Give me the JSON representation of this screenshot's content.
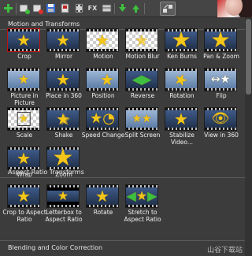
{
  "toolbar": {
    "buttons": [
      {
        "icon": "add-icon"
      },
      {
        "icon": "add-media-icon"
      },
      {
        "icon": "remove-media-icon"
      },
      {
        "icon": "save-icon"
      },
      {
        "icon": "clip-icon"
      },
      {
        "icon": "film-icon"
      },
      {
        "icon": "fx-icon"
      },
      {
        "icon": "sequence-icon"
      },
      {
        "icon": "move-down-icon"
      },
      {
        "icon": "move-up-icon"
      },
      {
        "icon": "transitions-icon"
      }
    ],
    "fx_label": "FX"
  },
  "sections": [
    {
      "title": "Motion and Transforms",
      "effects": [
        {
          "label": "Crop"
        },
        {
          "label": "Mirror"
        },
        {
          "label": "Motion"
        },
        {
          "label": "Motion Blur"
        },
        {
          "label": "Ken Burns"
        },
        {
          "label": "Pan & Zoom"
        },
        {
          "label": "Picture in Picture"
        },
        {
          "label": "Place in 360"
        },
        {
          "label": "Position"
        },
        {
          "label": "Reverse"
        },
        {
          "label": "Rotation"
        },
        {
          "label": "Flip"
        },
        {
          "label": "Scale"
        },
        {
          "label": "Shake"
        },
        {
          "label": "Speed Change"
        },
        {
          "label": "Split Screen"
        },
        {
          "label": "Stabilize Video..."
        },
        {
          "label": "View in 360"
        },
        {
          "label": "Wrap"
        },
        {
          "label": "Zoom"
        }
      ]
    },
    {
      "title": "Aspect Ratio Transforms",
      "effects": [
        {
          "label": "Crop to Aspect Ratio"
        },
        {
          "label": "Letterbox to Aspect Ratio"
        },
        {
          "label": "Rotate"
        },
        {
          "label": "Stretch to Aspect Ratio"
        }
      ]
    },
    {
      "title": "Blending and Color Correction",
      "effects": []
    }
  ],
  "watermark": "山谷下载站",
  "colors": {
    "star": "#f4c61a",
    "panel_bg": "#3c3c3c",
    "thumb_bg": "#2a3b55"
  }
}
